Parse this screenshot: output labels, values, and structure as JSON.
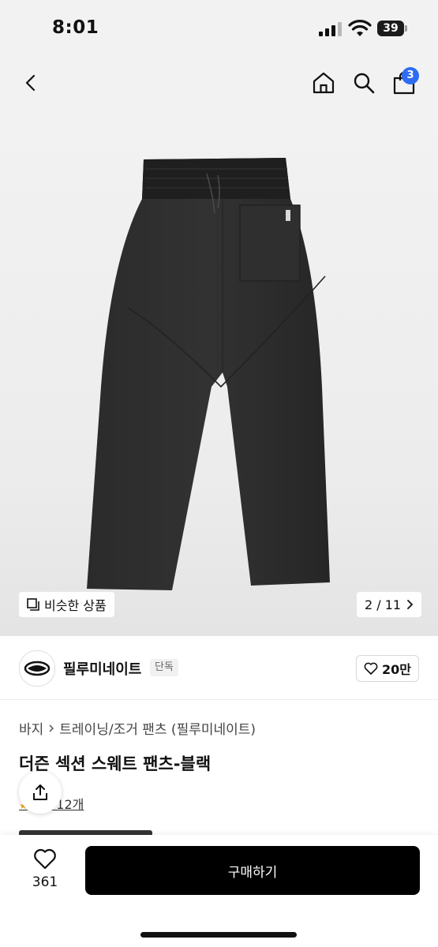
{
  "status_bar": {
    "time": "8:01",
    "battery": "39"
  },
  "nav": {
    "cart_count": "3"
  },
  "gallery": {
    "similar_label": "비슷한 상품",
    "page_indicator": "2 / 11"
  },
  "brand": {
    "name": "필루미네이트",
    "badge": "단독",
    "likes": "20만"
  },
  "product": {
    "breadcrumb": [
      "바지",
      "트레이닝/조거 팬츠 (필루미네이트)"
    ],
    "title": "더즌 섹션 스웨트 팬츠-블랙",
    "review_link": "후기 12개"
  },
  "bottom": {
    "like_count": "361",
    "buy_label": "구매하기"
  }
}
